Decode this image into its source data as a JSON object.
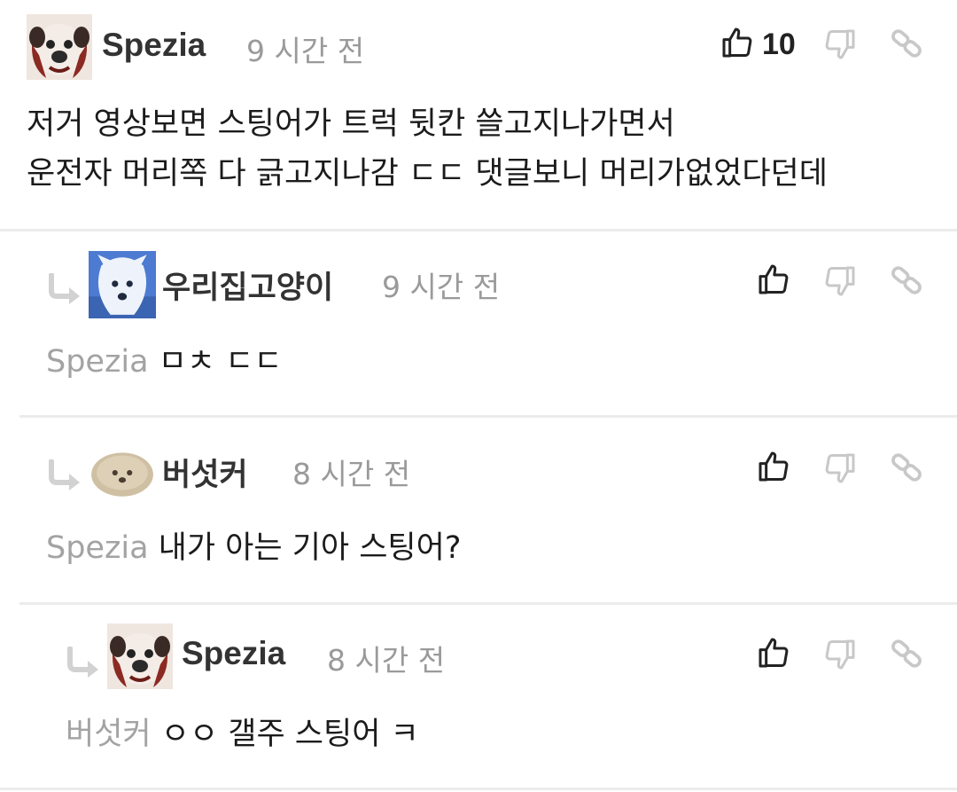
{
  "comments": [
    {
      "author": "Spezia",
      "time": "9 시간 전",
      "likes": "10",
      "avatar": "pug-avatar",
      "lines": [
        "저거 영상보면 스팅어가 트럭 뒷칸 쓸고지나가면서",
        "운전자 머리쪽 다 긁고지나감 ㄷㄷ 댓글보니 머리가없었다던데"
      ]
    },
    {
      "author": "우리집고양이",
      "time": "9 시간 전",
      "avatar": "white-dog-avatar",
      "mention": "Spezia",
      "text": "ㅁㅊ ㄷㄷ"
    },
    {
      "author": "버섯커",
      "time": "8 시간 전",
      "avatar": "fluffy-dog-avatar",
      "mention": "Spezia",
      "text": "내가 아는 기아 스팅어?"
    },
    {
      "author": "Spezia",
      "time": "8 시간 전",
      "avatar": "pug-avatar",
      "mention": "버섯커",
      "text": "ㅇㅇ 갤주 스팅어 ㅋ"
    }
  ],
  "icons": {
    "like": "thumbs-up-icon",
    "dislike": "thumbs-down-icon",
    "link": "link-icon",
    "reply": "reply-arrow-icon"
  },
  "colors": {
    "icon_dark": "#222222",
    "icon_light": "#c8c8c8",
    "mention": "#a3a3a3",
    "separator": "#ececec"
  }
}
